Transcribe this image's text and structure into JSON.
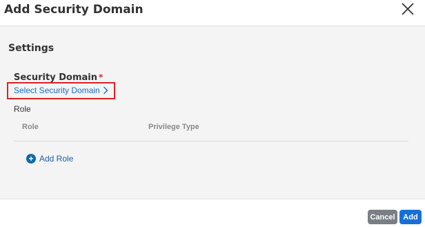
{
  "dialog": {
    "title": "Add Security Domain"
  },
  "settings": {
    "section_title": "Settings",
    "security_domain_label": "Security Domain",
    "required_marker": "*",
    "select_link": "Select Security Domain",
    "role_label": "Role",
    "table_headers": [
      "Role",
      "Privilege Type"
    ],
    "add_role_label": "Add Role"
  },
  "footer": {
    "cancel_label": "Cancel",
    "add_label": "Add"
  },
  "colors": {
    "link": "#1a6fc9",
    "highlight": "#e02020",
    "required": "#d4282b",
    "cancel_button": "#7a7f85",
    "add_button": "#1a6fd6"
  },
  "icons": {
    "close": "close-icon",
    "chevron": "chevron-right-icon",
    "add": "plus-circle-icon"
  }
}
